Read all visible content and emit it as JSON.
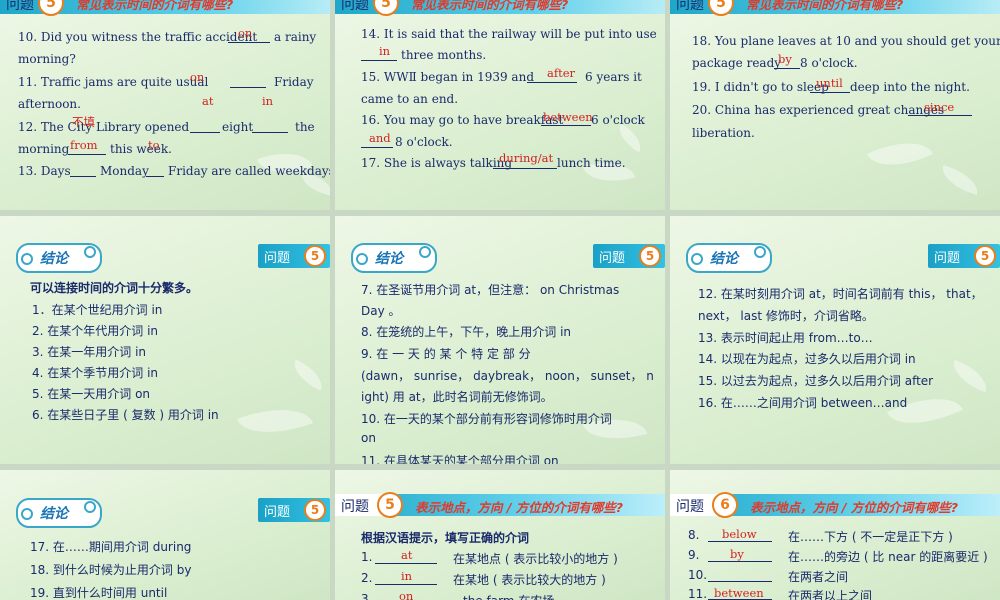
{
  "q_label": "问题",
  "q_num_5": "5",
  "q_num_6": "6",
  "conclusion_label": "结论",
  "time_title": "常见表示时间的介词有哪些?",
  "place_title": "表示地点，方向 / 方位的介词有哪些?",
  "s1": {
    "l10a": "10. Did you witness the traffic accident",
    "l10b": "a rainy",
    "l10c": "morning?",
    "a10": "on",
    "l11a": "11.  Traffic  jams  are  quite  usual",
    "l11b": "Friday",
    "l11c": "afternoon.",
    "a11a": "at",
    "a11b": "in",
    "a11c": "on",
    "l12a": "12.  The  City  Library  opened",
    "l12b": "eight",
    "l12c": "the",
    "l12d": "morning",
    "l12e": "this week.",
    "a12a": "from",
    "a12b": "to",
    "a12c": "不填",
    "l13a": "13. Days",
    "l13b": "Monday",
    "l13c": "Friday are called weekdays."
  },
  "s2": {
    "l14a": "14.  It  is  said  that  the  railway  will  be  put  into  use",
    "l14b": "three months.",
    "a14": "in",
    "l15a": "15.  WWⅡ  began  in  1939  and",
    "l15b": "6  years  it",
    "l15c": "came to an end.",
    "a15": "after",
    "l16a": "16. You may go to have breakfast",
    "l16b": "6 o'clock",
    "l16c": "8 o'clock.",
    "a16a": "between",
    "a16b": "and",
    "l17a": "17. She is always talking",
    "l17b": "lunch time.",
    "a17": "during/at"
  },
  "s3": {
    "l18a": "18.  You  plane  leaves  at  10  and  you  should  get  your",
    "l18b": "package ready",
    "l18c": "8 o'clock.",
    "a18": "by",
    "l19a": "19. I didn't go to sleep",
    "l19b": "deep into the night.",
    "a19": "until",
    "l20a": "20. China has experienced great changes",
    "l20b": "liberation.",
    "a20": "since"
  },
  "s4": {
    "head": "可以连接时间的介词十分繁多。",
    "items": [
      "1．在某个世纪用介词 in",
      "2. 在某个年代用介词 in",
      "3. 在某一年用介词 in",
      "4. 在某个季节用介词 in",
      "5. 在某一天用介词 on",
      "6. 在某些日子里 ( 复数 ) 用介词 in"
    ]
  },
  "s5": {
    "i7a": "7.  在圣诞节用介词 at，但注意： on Christmas",
    "i7b": "Day 。",
    "i8": "8.  在笼统的上午，下午，晚上用介词 in",
    "i9a": "9.   在   一   天   的   某   个   特   定   部   分",
    "i9b": "(dawn， sunrise， daybreak， noon， sunset， n",
    "i9c": "ight) 用 at，此时名词前无修饰词。",
    "i10a": "10.  在一天的某个部分前有形容词修饰时用介词",
    "i10b": "on",
    "i11": "11.  在具体某天的某个部分用介词 on"
  },
  "s6": {
    "i12a": "12.  在某时刻用介词 at，时间名词前有 this，  that，",
    "i12b": "next，  last 修饰时，介词省略。",
    "i13": "13.  表示时间起止用 from…to…",
    "i14": "14.  以现在为起点，过多久以后用介词    in",
    "i15": "15.  以过去为起点，过多久以后用介词 after",
    "i16": "16.  在……之间用介词 between…and"
  },
  "s7": {
    "i17": "17.  在……期间用介词 during",
    "i18": "18.  到什么时候为止用介词 by",
    "i19": "19.  直到什么时间用 until"
  },
  "s8": {
    "head": "根据汉语提示，填写正确的介词",
    "r1n": "1.",
    "r1a": "at",
    "r1t": "在某地点 ( 表示比较小的地方 )",
    "r2n": "2.",
    "r2a": "in",
    "r2t": "在某地 ( 表示比较大的地方 )",
    "r3n": "3.",
    "r3a": "on",
    "r3t": "the farm 在农场"
  },
  "s9": {
    "r8n": "8.",
    "r8a": "below",
    "r8t": "在……下方 ( 不一定是正下方 )",
    "r9n": "9.",
    "r9a": "by",
    "r9t": "在……的旁边 ( 比 near 的距离要近 )",
    "r10n": "10.",
    "r10t": "在两者之间",
    "r11n": "11.",
    "r11a": "between",
    "r11t": "在两者以上之间"
  }
}
